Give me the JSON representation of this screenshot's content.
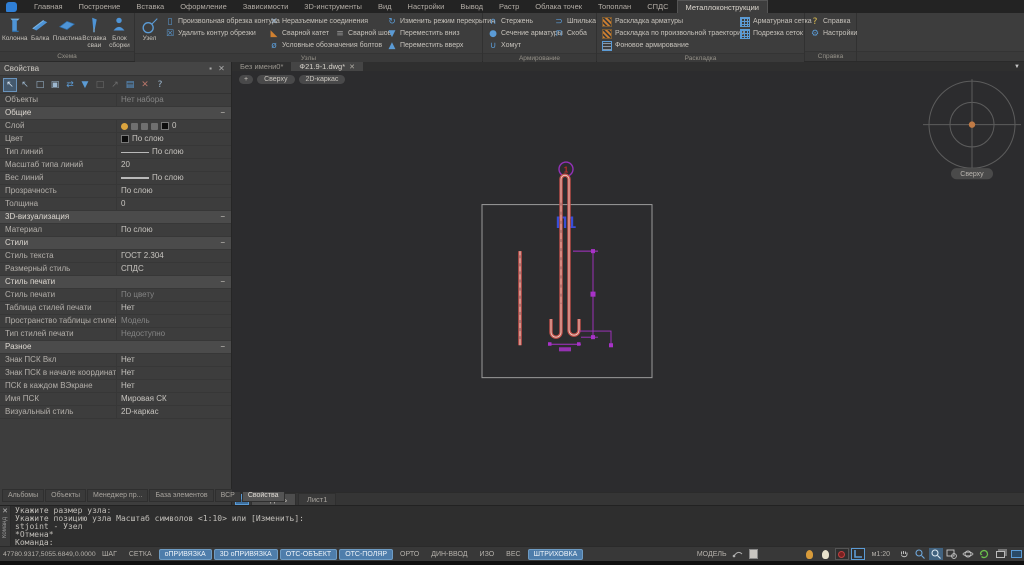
{
  "colors": {
    "accent": "#5b9bd5",
    "toggle_active": "#4e7dab",
    "rebar_red": "#c4504a",
    "dim_magenta": "#a832c8",
    "part_label_blue": "#3a4ed6"
  },
  "tabbar": {
    "tabs": [
      "Главная",
      "Построение",
      "Вставка",
      "Оформление",
      "Зависимости",
      "3D-инструменты",
      "Вид",
      "Настройки",
      "Вывод",
      "Растр",
      "Облака точек",
      "Топоплан",
      "СПДС",
      "Металлоконструкции"
    ]
  },
  "ribbon": {
    "schema": {
      "label": "Схема",
      "buttons": [
        "Колонна",
        "Балка",
        "Пластина",
        "Вставка сваи",
        "Блок сборки"
      ]
    },
    "uzly": {
      "label": "Узлы",
      "big": "Узел",
      "a1": "Произвольная обрезка контура",
      "a2": "Удалить контур обрезки",
      "b1": "Неразъемные соединения",
      "b2a": "Сварной катет",
      "b2b": "Сварной шов",
      "b3": "Условные обозначения болтов",
      "c1": "Изменить режим перекрытия",
      "c2": "Переместить вниз",
      "c3": "Переместить вверх"
    },
    "armir": {
      "label": "Армирование",
      "a1": "Стержень",
      "a2": "Сечение арматуры",
      "a3": "Хомут",
      "b1": "Шпилька",
      "b2": "Скоба"
    },
    "rask": {
      "label": "Раскладка",
      "a1": "Раскладка арматуры",
      "a2": "Раскладка по произвольной траектории",
      "a3": "Фоновое армирование",
      "b1": "Арматурная сетка",
      "b2": "Подрезка сеток"
    },
    "help": {
      "label": "Справка",
      "i1": "Справка",
      "i2": "Настройки"
    }
  },
  "props": {
    "title": "Свойства",
    "rows": [
      {
        "label": "Объекты",
        "value": "Нет набора"
      },
      {
        "label": "Общие"
      },
      {
        "label": "Слой",
        "value": "0"
      },
      {
        "label": "Цвет",
        "value": "По слою"
      },
      {
        "label": "Тип линий",
        "value": "По слою"
      },
      {
        "label": "Масштаб типа линий",
        "value": "20"
      },
      {
        "label": "Вес линий",
        "value": "По слою"
      },
      {
        "label": "Прозрачность",
        "value": "По слою"
      },
      {
        "label": "Толщина",
        "value": "0"
      },
      {
        "label": "3D-визуализация"
      },
      {
        "label": "Материал",
        "value": "По слою"
      },
      {
        "label": "Стили"
      },
      {
        "label": "Стиль текста",
        "value": "ГОСТ 2.304"
      },
      {
        "label": "Размерный стиль",
        "value": "СПДС"
      },
      {
        "label": "Стиль печати"
      },
      {
        "label": "Стиль печати",
        "value": "По цвету"
      },
      {
        "label": "Таблица стилей печати",
        "value": "Нет"
      },
      {
        "label": "Пространство таблицы стилей печати",
        "value": "Модель"
      },
      {
        "label": "Тип стилей печати",
        "value": "Недоступно"
      },
      {
        "label": "Разное"
      },
      {
        "label": "Знак ПСК Вкл",
        "value": "Нет"
      },
      {
        "label": "Знак ПСК в начале координат",
        "value": "Нет"
      },
      {
        "label": "ПСК в каждом ВЭкране",
        "value": "Нет"
      },
      {
        "label": "Имя ПСК",
        "value": "Мировая СК"
      },
      {
        "label": "Визуальный стиль",
        "value": "2D-каркас"
      }
    ],
    "tabs": [
      "Альбомы",
      "Объекты",
      "Менеджер пр...",
      "База элементов",
      "ВСР",
      "Свойства"
    ]
  },
  "docbar": {
    "tab_inactive": "Без имени0*",
    "tab_active": "Ф21.9-1.dwg*"
  },
  "viewport": {
    "btn_plus": "+",
    "btn_view": "Сверху",
    "btn_style": "2D-каркас"
  },
  "canvas": {
    "part_label": "П1",
    "position_number": "1",
    "compass_label": "Сверху"
  },
  "sheetbar": {
    "tab_model": "Модель",
    "tab_layout": "Лист1"
  },
  "cmdline": {
    "line1": "Укажите размер узла:",
    "line2": "Укажите позицию узла Масштаб символов <1:10> или [Изменить]:",
    "line3": "stjoint - Узел",
    "line4": "*Отмена*",
    "line5": "Команда:",
    "panel_label": "Команд"
  },
  "statusbar": {
    "coords": "47780.9317,5055.6849,0.0000",
    "t1": "ШАГ",
    "t2": "СЕТКА",
    "t3": "оПРИВЯЗКА",
    "t4": "3D оПРИВЯЗКА",
    "t5": "ОТС-ОБЪЕКТ",
    "t6": "ОТС-ПОЛЯР",
    "t7": "ОРТО",
    "t8": "ДИН-ВВОД",
    "t9": "ИЗО",
    "t10": "ВЕС",
    "t11": "ШТРИХОВКА",
    "model": "МОДЕЛЬ",
    "scale": "м1:20"
  }
}
